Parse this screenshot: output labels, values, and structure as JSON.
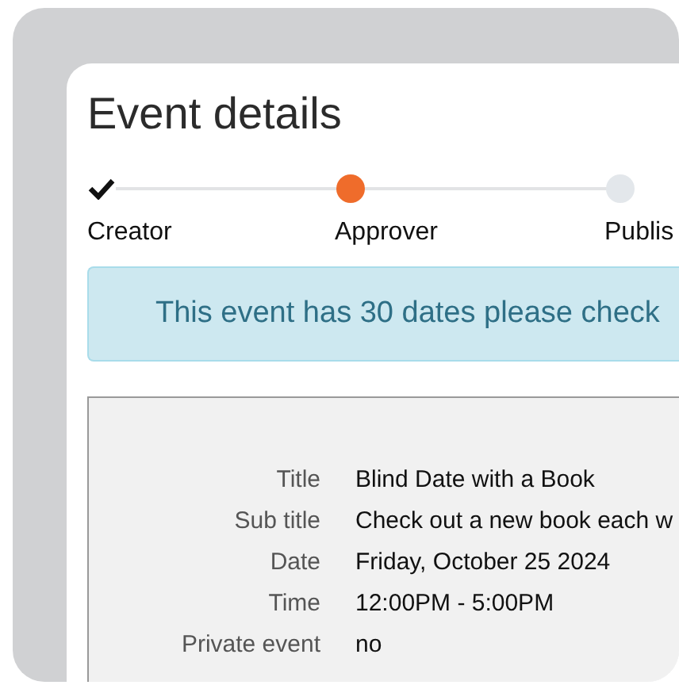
{
  "title": "Event details",
  "steps": [
    {
      "label": "Creator",
      "kind": "done"
    },
    {
      "label": "Approver",
      "kind": "current"
    },
    {
      "label": "Publis",
      "kind": "pending"
    }
  ],
  "alert": "This event has 30 dates please check",
  "details": [
    {
      "label": "Title",
      "value": "Blind Date with a Book"
    },
    {
      "label": "Sub title",
      "value": "Check out a new book each w"
    },
    {
      "label": "Date",
      "value": "Friday, October 25 2024"
    },
    {
      "label": "Time",
      "value": "12:00PM - 5:00PM"
    },
    {
      "label": "Private event",
      "value": "no"
    }
  ]
}
